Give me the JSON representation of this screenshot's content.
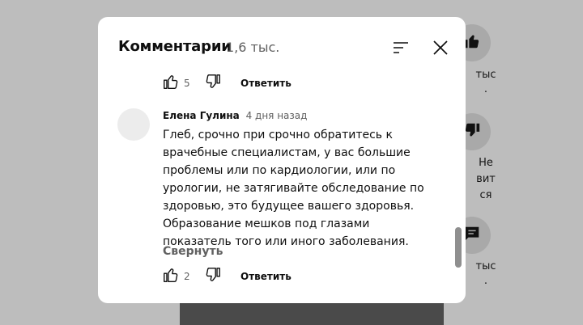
{
  "background": {
    "side_actions": [
      {
        "icon": "thumb-up-icon",
        "label": "тыс"
      },
      {
        "icon": "thumb-down-icon",
        "label_lines": [
          "Не",
          "вит",
          "ся"
        ]
      },
      {
        "icon": "comment-icon",
        "label": "тыс"
      }
    ]
  },
  "modal": {
    "title": "Комментарии",
    "count": "1,6 тыс.",
    "sort_icon": "sort-icon",
    "close_icon": "close-icon"
  },
  "previous_comment": {
    "likes": "5",
    "reply_label": "Ответить"
  },
  "comment": {
    "author": "Елена Гулина",
    "time_ago": "4 дня назад",
    "lines": [
      "Глеб, срочно при срочно обратитесь к",
      "врачебные специалистам, у вас большие",
      "проблемы или по кардиологии, или по",
      "урологии, не затягивайте обследование по",
      "здоровью, это будущее вашего здоровья.",
      "Образование мешков под глазами",
      "показатель того или иного заболевания."
    ],
    "collapse_label": "Свернуть",
    "likes": "2",
    "reply_label": "Ответить"
  },
  "colors": {
    "overlay": "#bdbdbd",
    "modal_bg": "#ffffff",
    "secondary_text": "#606060",
    "scrollbar": "#8f8f8f"
  }
}
